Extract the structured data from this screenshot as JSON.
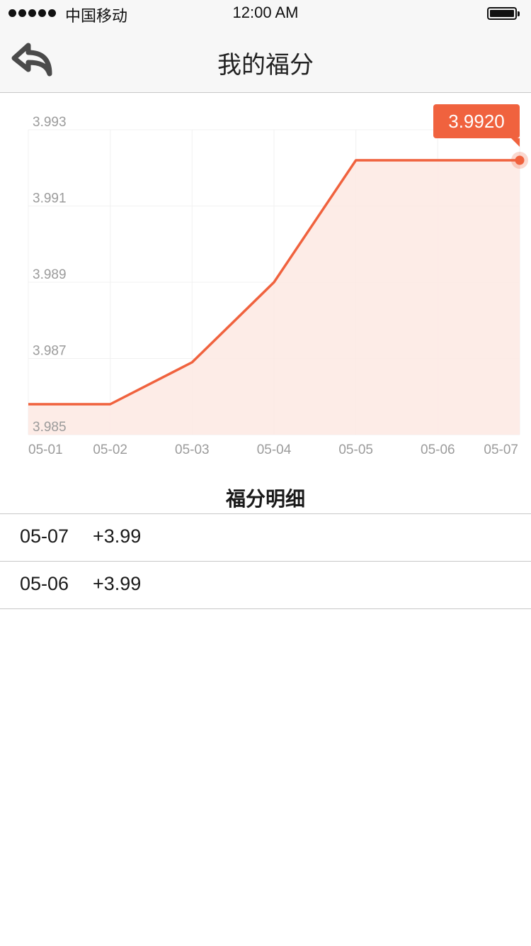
{
  "status_bar": {
    "carrier": "中国移动",
    "time": "12:00 AM"
  },
  "nav": {
    "title": "我的福分"
  },
  "chart_data": {
    "type": "area",
    "x": [
      "05-01",
      "05-02",
      "05-03",
      "05-04",
      "05-05",
      "05-06",
      "05-07"
    ],
    "values": [
      3.9858,
      3.9858,
      3.9869,
      3.989,
      3.9922,
      3.9922,
      3.9922
    ],
    "y_ticks": [
      "3.993",
      "3.991",
      "3.989",
      "3.987",
      "3.985"
    ],
    "ylim": [
      3.985,
      3.993
    ],
    "grid": true,
    "tooltip_label": "3.9920",
    "colors": {
      "line": "#f0623e",
      "fill": "#fde9e3",
      "tooltip_bg": "#f0623e",
      "grid": "#f1f1f1",
      "tick_text": "#9b9b9b"
    }
  },
  "details": {
    "title": "福分明细",
    "rows": [
      {
        "date": "05-07",
        "amount": "+3.99"
      },
      {
        "date": "05-06",
        "amount": "+3.99"
      }
    ]
  }
}
